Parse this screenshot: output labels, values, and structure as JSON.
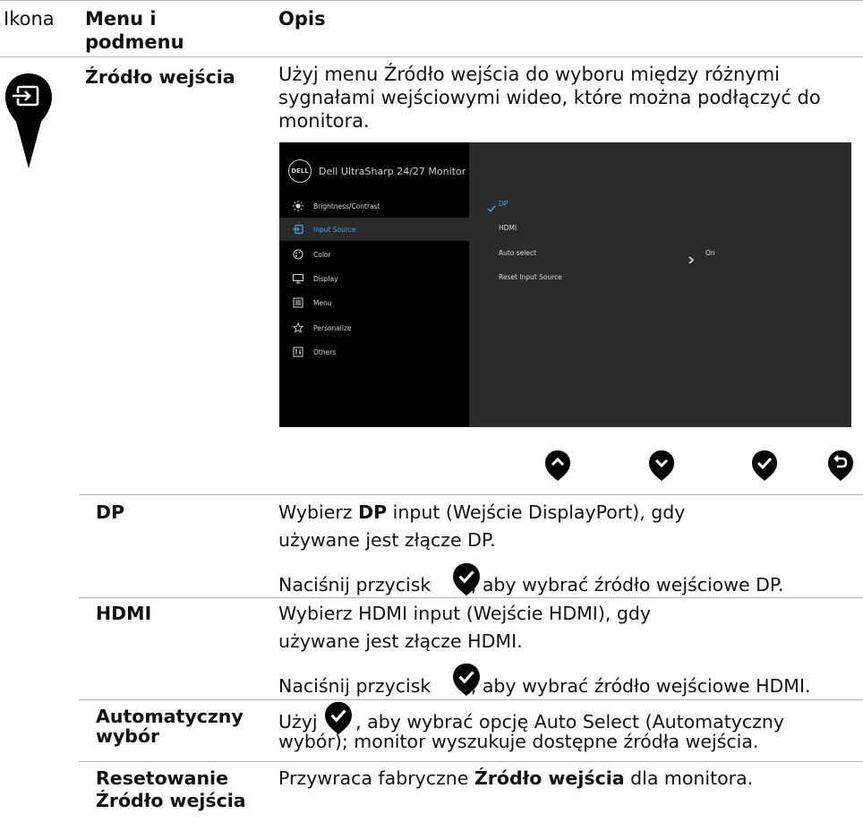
{
  "header": {
    "col_icon": "Ikona",
    "col_menu": "Menu i podmenu",
    "col_desc": "Opis"
  },
  "section": {
    "title": "Źródło wejścia",
    "description": "Użyj menu Źródło wejścia do wyboru między różnymi sygnałami wejściowymi wideo, które można podłączyć do monitora."
  },
  "osd": {
    "title": "Dell UltraSharp 24/27 Monitor",
    "logo": "DELL",
    "menu": [
      {
        "label": "Brightness/Contrast",
        "icon": "brightness-icon"
      },
      {
        "label": "Input Source",
        "icon": "input-source-icon"
      },
      {
        "label": "Color",
        "icon": "color-icon"
      },
      {
        "label": "Display",
        "icon": "display-icon"
      },
      {
        "label": "Menu",
        "icon": "menu-icon"
      },
      {
        "label": "Personalize",
        "icon": "star-icon"
      },
      {
        "label": "Others",
        "icon": "others-icon"
      }
    ],
    "submenu": {
      "dp": "DP",
      "hdmi": "HDMI",
      "auto_select": "Auto select",
      "auto_value": "On",
      "reset": "Reset Input Source"
    }
  },
  "rows": {
    "dp": {
      "name": "DP",
      "l1_a": "Wybierz ",
      "l1_b": "DP",
      "l1_c": " input (Wejście DisplayPort), gdy",
      "l2": "używane jest złącze DP.",
      "l3_a": "Naciśnij przycisk ",
      "l3_b": ", aby wybrać źródło wejściowe DP."
    },
    "hdmi": {
      "name": "HDMI",
      "l1": "Wybierz HDMI input (Wejście HDMI), gdy",
      "l2": "używane jest złącze HDMI.",
      "l3_a": "Naciśnij przycisk ",
      "l3_b": ", aby wybrać źródło wejściowe HDMI."
    },
    "auto": {
      "name_1": "Automatyczny",
      "name_2": "wybór",
      "l1_a": "Użyj ",
      "l1_b": ", aby wybrać opcję Auto Select (Automatyczny",
      "l2": "wybór); monitor wyszukuje dostępne źródła wejścia."
    },
    "reset": {
      "name_1": "Resetowanie",
      "name_2": "Źródło wejścia",
      "d_a": "Przywraca fabryczne ",
      "d_b": "Źródło wejścia",
      "d_c": " dla monitora."
    }
  }
}
